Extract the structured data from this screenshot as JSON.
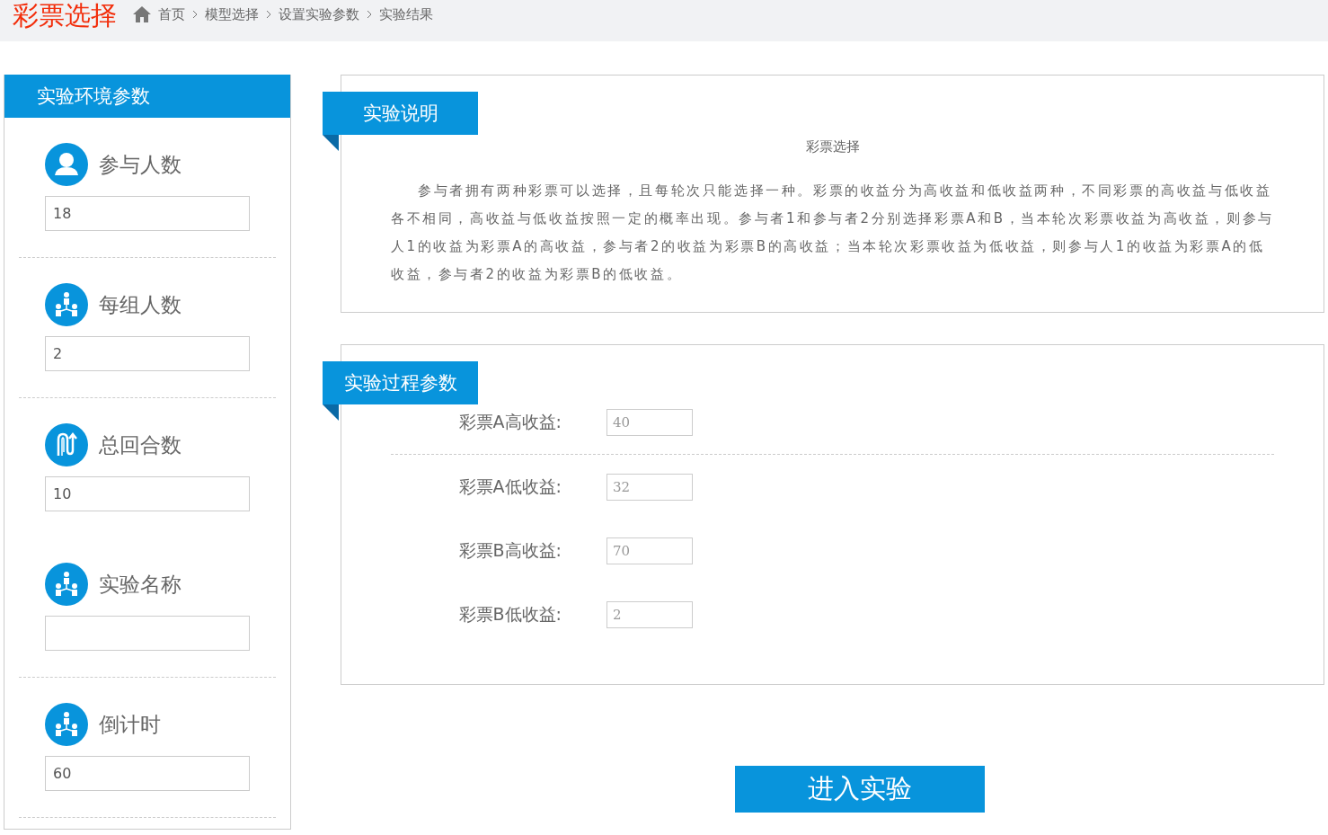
{
  "header": {
    "title": "彩票选择",
    "breadcrumb": [
      "首页",
      "模型选择",
      "设置实验参数",
      "实验结果"
    ]
  },
  "env_panel": {
    "title": "实验环境参数",
    "items": [
      {
        "label": "参与人数",
        "kind": "person",
        "value": "18",
        "divider_after": true
      },
      {
        "label": "每组人数",
        "kind": "group",
        "value": "2",
        "divider_after": true
      },
      {
        "label": "总回合数",
        "kind": "loop",
        "value": "10",
        "divider_after": false
      },
      {
        "label": "实验名称",
        "kind": "group",
        "value": "",
        "divider_after": true
      },
      {
        "label": "倒计时",
        "kind": "group",
        "value": "60",
        "divider_after": true
      }
    ]
  },
  "description": {
    "tab": "实验说明",
    "heading": "彩票选择",
    "text": "参与者拥有两种彩票可以选择，且每轮次只能选择一种。彩票的收益分为高收益和低收益两种，不同彩票的高收益与低收益各不相同，高收益与低收益按照一定的概率出现。参与者1和参与者2分别选择彩票A和B，当本轮次彩票收益为高收益，则参与人1的收益为彩票A的高收益，参与者2的收益为彩票B的高收益；当本轮次彩票收益为低收益，则参与人1的收益为彩票A的低收益，参与者2的收益为彩票B的低收益。"
  },
  "process": {
    "tab": "实验过程参数",
    "params": [
      {
        "label": "彩票A高收益:",
        "value": "40",
        "divider_after": true
      },
      {
        "label": "彩票A低收益:",
        "value": "32",
        "divider_after": false
      },
      {
        "label": "彩票B高收益:",
        "value": "70",
        "divider_after": false
      },
      {
        "label": "彩票B低收益:",
        "value": "2",
        "divider_after": false
      }
    ]
  },
  "start_button": "进入实验"
}
